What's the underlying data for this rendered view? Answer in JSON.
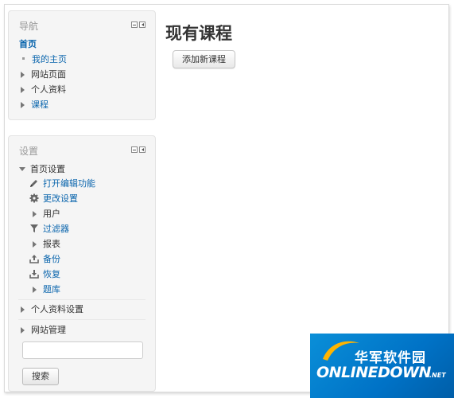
{
  "navigation": {
    "title": "导航",
    "items": [
      {
        "label": "首页",
        "kind": "current"
      },
      {
        "label": "我的主页",
        "kind": "link"
      },
      {
        "label": "网站页面",
        "kind": "collapsed"
      },
      {
        "label": "个人资料",
        "kind": "collapsed"
      },
      {
        "label": "课程",
        "kind": "link-collapsed"
      }
    ]
  },
  "settings": {
    "title": "设置",
    "front_page_settings": "首页设置",
    "items": [
      {
        "label": "打开编辑功能",
        "icon": "pencil-icon"
      },
      {
        "label": "更改设置",
        "icon": "gear-icon"
      },
      {
        "label": "用户",
        "icon": "collapsed"
      },
      {
        "label": "过滤器",
        "icon": "filter-icon"
      },
      {
        "label": "报表",
        "icon": "collapsed"
      },
      {
        "label": "备份",
        "icon": "upload-icon"
      },
      {
        "label": "恢复",
        "icon": "download-icon"
      },
      {
        "label": "题库",
        "icon": "collapsed"
      }
    ],
    "profile_settings": "个人资料设置",
    "site_admin": "网站管理",
    "search": {
      "value": "",
      "button_label": "搜索"
    }
  },
  "main": {
    "title": "现有课程",
    "add_button_label": "添加新课程"
  },
  "watermark": {
    "cn": "华军软件园",
    "en": "ONLINEDOWN",
    "net": ".NET"
  },
  "colors": {
    "link": "#0a65ad",
    "block_bg": "#f5f5f5",
    "watermark_bg": "#0072c6"
  }
}
